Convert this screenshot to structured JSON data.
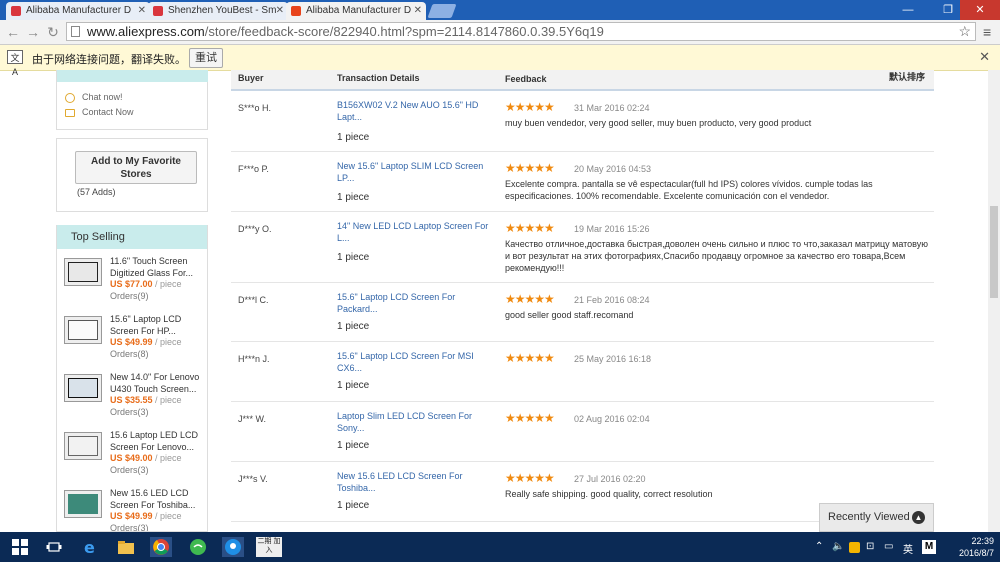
{
  "browser": {
    "tabs": [
      {
        "title": "Alibaba Manufacturer D",
        "favicon_color": "#d9363e",
        "active": false
      },
      {
        "title": "Shenzhen YouBest - Sm",
        "favicon_color": "#d9363e",
        "active": false
      },
      {
        "title": "Alibaba Manufacturer D",
        "favicon_color": "#e8431a",
        "active": true
      }
    ],
    "url_host": "www.aliexpress.com",
    "url_path": "/store/feedback-score/822940.html?spm=2114.8147860.0.39.5Y6q19"
  },
  "translate_bar": {
    "message": "由于网络连接问题，翻译失败。",
    "retry_label": "重试"
  },
  "sidebar": {
    "chat_label": "Chat now!",
    "contact_label": "Contact Now",
    "favorite_button": "Add to My Favorite Stores",
    "favorite_count": "(57 Adds)",
    "top_selling_title": "Top Selling",
    "items": [
      {
        "title": "11.6\" Touch Screen Digitized Glass For...",
        "price": "US $77.00",
        "unit": " / piece",
        "orders": "Orders(9)"
      },
      {
        "title": "15.6\" Laptop LCD Screen For HP...",
        "price": "US $49.99",
        "unit": " / piece",
        "orders": "Orders(8)"
      },
      {
        "title": "New 14.0\" For Lenovo U430 Touch Screen...",
        "price": "US $35.55",
        "unit": " / piece",
        "orders": "Orders(3)"
      },
      {
        "title": "15.6 Laptop LED LCD Screen For Lenovo...",
        "price": "US $49.00",
        "unit": " / piece",
        "orders": "Orders(3)"
      },
      {
        "title": "New 15.6 LED LCD Screen For Toshiba...",
        "price": "US $49.99",
        "unit": " / piece",
        "orders": "Orders(3)"
      }
    ]
  },
  "feedback": {
    "header_buyer": "Buyer",
    "header_transaction": "Transaction Details",
    "header_feedback": "Feedback",
    "header_sort": "默认排序",
    "rows": [
      {
        "buyer": "S***o H.",
        "product": "B156XW02 V.2 New AUO 15.6\" HD Lapt...",
        "qty": "1 piece",
        "stars": "★★★★★",
        "date": "31 Mar 2016 02:24",
        "comment": "muy buen vendedor, very good seller, muy buen producto, very good product"
      },
      {
        "buyer": "F***o P.",
        "product": "New 15.6\" Laptop SLIM LCD Screen LP...",
        "qty": "1 piece",
        "stars": "★★★★★",
        "date": "20 May 2016 04:53",
        "comment": "Excelente compra. pantalla se vê espectacular(full hd IPS) colores vívidos. cumple todas las especificaciones. 100% recomendable. Excelente comunicación con el vendedor."
      },
      {
        "buyer": "D***y O.",
        "product": "14\" New LED LCD Laptop Screen For L...",
        "qty": "1 piece",
        "stars": "★★★★★",
        "date": "19 Mar 2016 15:26",
        "comment": "Качество отличное,доставка быстрая,доволен очень сильно и плюс то что,заказал матрицу матовую и вот результат на этих фотографиях,Спасибо продавцу огромное за качество его товара,Всем рекомендую!!!"
      },
      {
        "buyer": "D***l C.",
        "product": "15.6\" Laptop LCD Screen For Packard...",
        "qty": "1 piece",
        "stars": "★★★★★",
        "date": "21 Feb 2016 08:24",
        "comment": "good seller good staff.recomand"
      },
      {
        "buyer": "H***n J.",
        "product": "15.6\" Laptop LCD Screen For MSI CX6...",
        "qty": "1 piece",
        "stars": "★★★★★",
        "date": "25 May 2016 16:18",
        "comment": ""
      },
      {
        "buyer": "J*** W.",
        "product": "Laptop Slim LED LCD Screen For Sony...",
        "qty": "1 piece",
        "stars": "★★★★★",
        "date": "02 Aug 2016 02:04",
        "comment": ""
      },
      {
        "buyer": "J***s V.",
        "product": "New 15.6 LED LCD Screen For Toshiba...",
        "qty": "1 piece",
        "stars": "★★★★★",
        "date": "27 Jul 2016 02:20",
        "comment": "Really safe shipping. good quality, correct resolution"
      }
    ]
  },
  "recently_viewed": "Recently Viewed",
  "taskbar": {
    "time": "22:39",
    "date": "2016/8/7",
    "ime_label": "英",
    "app_label": "二期\n加入"
  }
}
